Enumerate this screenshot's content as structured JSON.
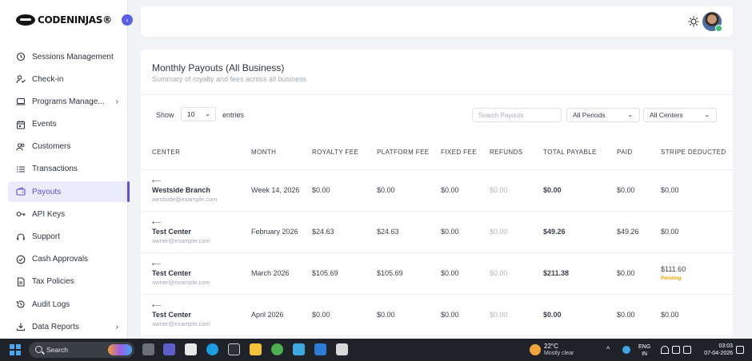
{
  "brand": {
    "logo_text": "CODENINJAS®"
  },
  "sidebar": {
    "items": [
      {
        "label": "Sessions Management",
        "icon": "sessions-icon"
      },
      {
        "label": "Check-in",
        "icon": "checkin-icon"
      },
      {
        "label": "Programs Manage...",
        "icon": "laptop-icon",
        "chevron": true
      },
      {
        "label": "Events",
        "icon": "calendar-icon"
      },
      {
        "label": "Customers",
        "icon": "users-icon"
      },
      {
        "label": "Transactions",
        "icon": "list-icon"
      },
      {
        "label": "Payouts",
        "icon": "wallet-icon",
        "active": true
      },
      {
        "label": "API Keys",
        "icon": "key-icon"
      },
      {
        "label": "Support",
        "icon": "headset-icon"
      },
      {
        "label": "Cash Approvals",
        "icon": "check-circle-icon"
      },
      {
        "label": "Tax Policies",
        "icon": "document-icon"
      },
      {
        "label": "Audit Logs",
        "icon": "history-icon"
      },
      {
        "label": "Data Reports",
        "icon": "download-icon",
        "chevron": true
      }
    ]
  },
  "card": {
    "title": "Monthly Payouts (All Business)",
    "subtitle": "Summary of royalty and fees across all business"
  },
  "controls": {
    "show_label": "Show",
    "entries_value": "10",
    "entries_label": "entries",
    "search_placeholder": "Search Payouts",
    "period_value": "All Periods",
    "center_value": "All Centers"
  },
  "table": {
    "headers": [
      "CENTER",
      "MONTH",
      "ROYALTY FEE",
      "PLATFORM FEE",
      "FIXED FEE",
      "REFUNDS",
      "TOTAL PAYABLE",
      "PAID",
      "STRIPE DEDUCTED"
    ],
    "rows": [
      {
        "flag": "⟵",
        "center": "Westside Branch",
        "email": "westside@example.com",
        "month": "Week 14, 2026",
        "royalty": "$0.00",
        "platform": "$0.00",
        "fixed": "$0.00",
        "refunds": "$0.00",
        "total": "$0.00",
        "paid": "$0.00",
        "stripe": "$0.00",
        "status": ""
      },
      {
        "flag": "⟵",
        "center": "Test Center",
        "email": "owner@example.com",
        "month": "February 2026",
        "royalty": "$24.63",
        "platform": "$24.63",
        "fixed": "$0.00",
        "refunds": "$0.00",
        "total": "$49.26",
        "paid": "$49.26",
        "stripe": "$0.00",
        "status": ""
      },
      {
        "flag": "⟵",
        "center": "Test Center",
        "email": "owner@example.com",
        "month": "March 2026",
        "royalty": "$105.69",
        "platform": "$105.69",
        "fixed": "$0.00",
        "refunds": "$0.00",
        "total": "$211.38",
        "paid": "$0.00",
        "stripe": "$111.60",
        "status": "Pending"
      },
      {
        "flag": "⟵",
        "center": "Test Center",
        "email": "owner@example.com",
        "month": "April 2026",
        "royalty": "$0.00",
        "platform": "$0.00",
        "fixed": "$0.00",
        "refunds": "$0.00",
        "total": "$0.00",
        "paid": "$0.00",
        "stripe": "$0.00",
        "status": ""
      }
    ]
  },
  "taskbar": {
    "search_label": "Search",
    "weather_temp": "22°C",
    "weather_desc": "Mostly clear",
    "lang_line1": "ENG",
    "lang_line2": "IN",
    "time": "03:03",
    "date": "07-04-2026"
  },
  "colors": {
    "accent": "#5b53d9",
    "pending": "#f0a400",
    "taskbar": "#1f2329"
  }
}
